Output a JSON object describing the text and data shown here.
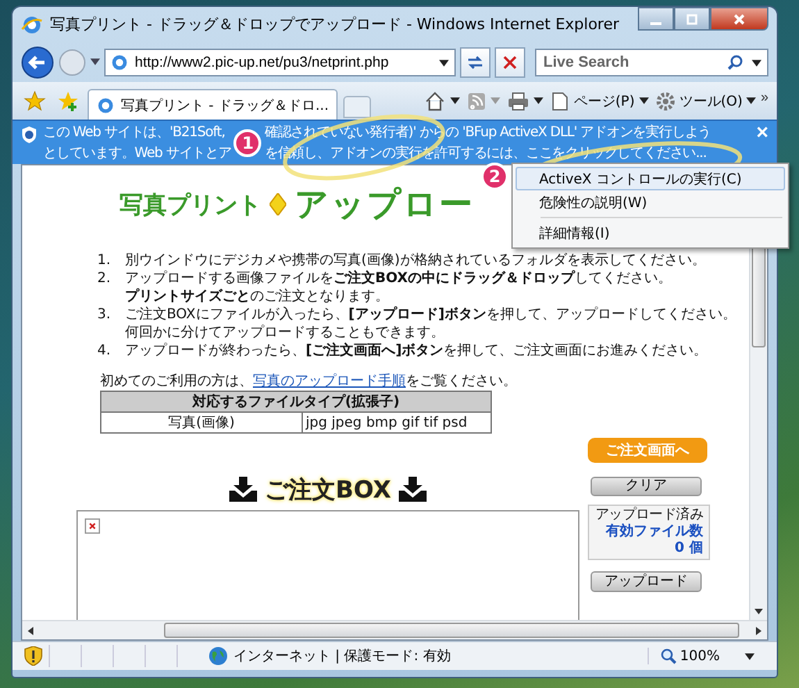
{
  "window": {
    "title": "写真プリント - ドラッグ＆ドロップでアップロード - Windows Internet Explorer"
  },
  "address_bar": {
    "value": "http://www2.pic-up.net/pu3/netprint.php"
  },
  "search": {
    "placeholder": "Live Search"
  },
  "tabs": [
    {
      "label": "写真プリント - ドラッグ＆ドロ...",
      "selected": true
    }
  ],
  "toolbar": {
    "page": "ページ(P)",
    "tools": "ツール(O)",
    "more": "»"
  },
  "infobar": {
    "lines": [
      [
        "この Web サイトは、'B21Soft, ",
        "確認されていない発行者)' からの 'BFup ActiveX DLL' アドオンを実行しよう"
      ],
      [
        "としています。Web サイトとア",
        "を信頼し、アドオンの実行を許可するには、ここをクリックしてください..."
      ]
    ],
    "close": "×"
  },
  "annotations": [
    "1",
    "2"
  ],
  "context_menu": [
    {
      "label": "ActiveX コントロールの実行(C)",
      "selected": true,
      "separator_before": false
    },
    {
      "label": "危険性の説明(W)",
      "selected": false,
      "separator_before": false
    },
    {
      "label": "詳細情報(I)",
      "selected": false,
      "separator_before": true
    }
  ],
  "page": {
    "heading_left": "写真プリント",
    "heading_right": "アップロー",
    "steps": [
      {
        "number": "1.",
        "lines": [
          "別ウインドウにデジカメや携帯の写真(画像)が格納されているフォルダを表示してください。"
        ]
      },
      {
        "number": "2.",
        "lines": [
          "アップロードする画像ファイルを**ご注文BOXの中にドラッグ＆ドロップ**してください。",
          "**プリントサイズごと**のご注文となります。"
        ]
      },
      {
        "number": "3.",
        "lines": [
          "ご注文BOXにファイルが入ったら、**[アップロード]ボタン**を押して、アップロードしてください。",
          "何回かに分けてアップロードすることもできます。"
        ]
      },
      {
        "number": "4.",
        "lines": [
          "アップロードが終わったら、**[ご注文画面へ]ボタン**を押して、ご注文画面にお進みください。"
        ]
      }
    ],
    "intro": "初めてのご利用の方は、",
    "link": "写真のアップロード手順",
    "intro_end": "をご覧ください。",
    "table": {
      "header": "対応するファイルタイプ(拡張子)",
      "rows": [
        [
          "写真(画像)",
          "jpg jpeg bmp gif tif psd"
        ]
      ]
    },
    "order_button": "ご注文画面へ",
    "clear_button": "クリア",
    "box_title": "ご注文BOX",
    "status": {
      "label": "アップロード済み",
      "count_label": "有効ファイル数",
      "count": "0 個"
    },
    "upload_button": "アップロード"
  },
  "status_bar": {
    "zone": "インターネット | 保護モード: 有効",
    "zoom": "100%"
  }
}
